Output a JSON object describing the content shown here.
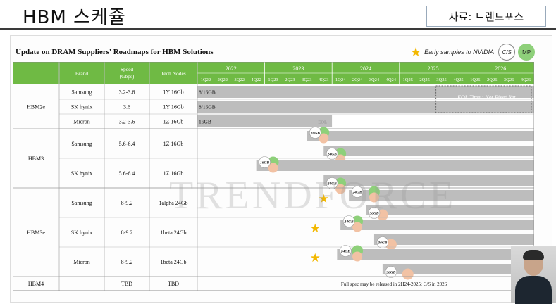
{
  "slide": {
    "title": "HBM 스케쥴",
    "source": "자료: 트렌드포스",
    "chart_title": "Update on DRAM Suppliers' Roadmaps for HBM Solutions",
    "footer": "···",
    "watermark": "TRENDFORCE"
  },
  "legend": {
    "star_text": "Early samples to NVIDIA",
    "cs_label": "C/S",
    "mp_label": "MP"
  },
  "colors": {
    "header_green": "#6fba44",
    "bar_gray": "#bdbdbd",
    "mp_green": "#8ed07a",
    "cs_orange": "#f2c2a4",
    "star_gold": "#f3b800"
  },
  "chart_data": {
    "type": "table",
    "columns": [
      "Brand",
      "Speed (Gbps)",
      "Tech Nodes"
    ],
    "years": [
      "2022",
      "2023",
      "2024",
      "2025",
      "2026"
    ],
    "quarters": [
      "1Q22",
      "2Q22",
      "3Q22",
      "4Q22",
      "1Q23",
      "2Q23",
      "3Q23",
      "4Q23",
      "1Q24",
      "2Q24",
      "3Q24",
      "4Q24",
      "1Q25",
      "2Q25",
      "3Q25",
      "4Q25",
      "1Q26",
      "2Q26",
      "3Q26",
      "4Q26"
    ],
    "eol_note": "EOL Time : Not Fixed Yet",
    "hbm4_note": "Full spec may be released in 2H24-2025; C/S in 2026",
    "groups": [
      {
        "name": "HBM2e",
        "rows": [
          {
            "brand": "Samsung",
            "speed": "3.2-3.6",
            "node": "1Y 16Gb",
            "bar_label": "8/16GB",
            "bar": [
              0,
              20
            ]
          },
          {
            "brand": "SK hynix",
            "speed": "3.6",
            "node": "1Y 16Gb",
            "bar_label": "8/16GB",
            "bar": [
              0,
              20
            ]
          },
          {
            "brand": "Micron",
            "speed": "3.2-3.6",
            "node": "1Z 16Gb",
            "bar_label": "16GB",
            "bar": [
              0,
              8
            ],
            "eol_label": "EOL"
          }
        ]
      },
      {
        "name": "HBM3",
        "rows": [
          {
            "brand": "Samsung",
            "speed": "5.6-6.4",
            "node": "1Z 16Gb",
            "sub": [
              {
                "label": "16GB",
                "bar": [
                  6.5,
                  20
                ],
                "cs": 6.5,
                "mp": 7
              },
              {
                "label": "24GB",
                "bar": [
                  7.5,
                  20
                ],
                "cs": 7.5,
                "mp": 8
              }
            ]
          },
          {
            "brand": "SK hynix",
            "speed": "5.6-6.4",
            "node": "1Z 16Gb",
            "sub": [
              {
                "label": "16GB",
                "bar": [
                  3.5,
                  20
                ],
                "cs": 3.5,
                "mp": 4
              },
              {
                "label": "24GB",
                "bar": [
                  7.5,
                  20
                ],
                "cs": 7.5,
                "mp": 8
              }
            ]
          }
        ]
      },
      {
        "name": "HBM3e",
        "rows": [
          {
            "brand": "Samsung",
            "speed": "8-9.2",
            "node": "1alpha 24Gb",
            "star": 7,
            "sub": [
              {
                "label": "24GB",
                "bar": [
                  9,
                  20
                ],
                "cs": 9,
                "mp": 10
              },
              {
                "label": "36GB",
                "bar": [
                  10,
                  20
                ],
                "cs": 10,
                "cs2": 10.5
              }
            ]
          },
          {
            "brand": "SK hynix",
            "speed": "8-9.2",
            "node": "1beta 24Gb",
            "star": 6.5,
            "sub": [
              {
                "label": "24GB",
                "bar": [
                  8.5,
                  20
                ],
                "cs": 8.5,
                "mp": 9
              },
              {
                "label": "36GB",
                "bar": [
                  10.5,
                  20
                ],
                "cs": 10.5,
                "cs2": 11
              }
            ]
          },
          {
            "brand": "Micron",
            "speed": "8-9.2",
            "node": "1beta 24Gb",
            "star": 6.5,
            "sub": [
              {
                "label": "24GB",
                "bar": [
                  8.3,
                  20
                ],
                "cs": 8.3,
                "mp": 9
              },
              {
                "label": "36GB",
                "bar": [
                  11,
                  20
                ],
                "cs": 11,
                "cs2": 12
              }
            ]
          }
        ]
      },
      {
        "name": "HBM4",
        "rows": [
          {
            "brand": "",
            "speed": "TBD",
            "node": "TBD"
          }
        ]
      }
    ]
  }
}
